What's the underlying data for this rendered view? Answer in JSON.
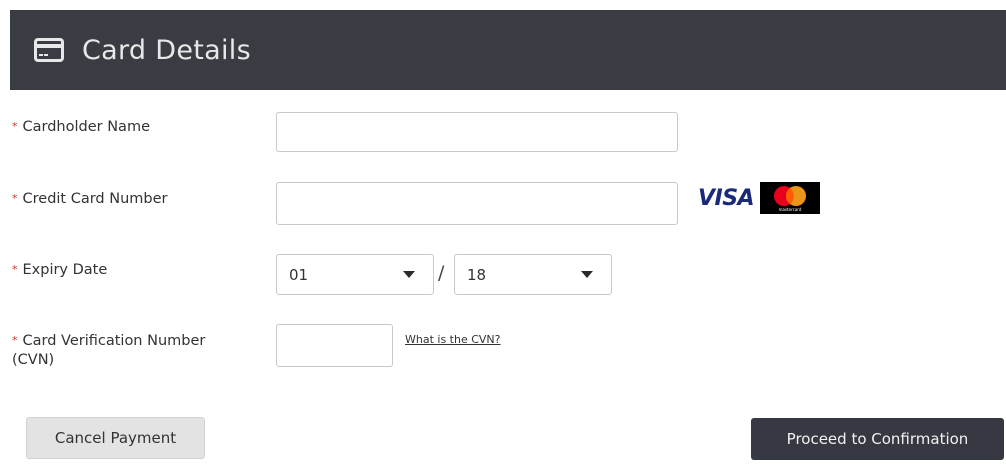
{
  "header": {
    "title": "Card Details",
    "icon": "credit-card-icon"
  },
  "required_mark": "*",
  "fields": {
    "cardholder_name": {
      "label": "Cardholder Name",
      "value": "",
      "placeholder": ""
    },
    "card_number": {
      "label": "Credit Card Number",
      "value": "",
      "placeholder": "",
      "brands": [
        "VISA",
        "mastercard"
      ]
    },
    "expiry": {
      "label": "Expiry Date",
      "month": "01",
      "year": "18",
      "separator": "/"
    },
    "cvn": {
      "label_line1": "Card Verification Number",
      "label_line2": "(CVN)",
      "value": "",
      "help_link": "What is the CVN?"
    }
  },
  "buttons": {
    "cancel": "Cancel Payment",
    "proceed": "Proceed to Confirmation"
  },
  "colors": {
    "header_bg": "#3a3c44",
    "required": "#d0392a",
    "primary_button": "#363842",
    "visa_blue": "#1a2a78",
    "mc_red": "#eb001b",
    "mc_orange": "#f79e1b"
  }
}
